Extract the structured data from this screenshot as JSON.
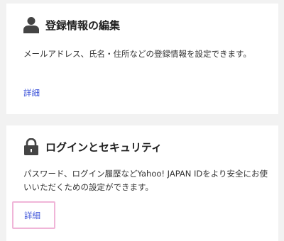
{
  "cards": [
    {
      "icon": "person-icon",
      "title": "登録情報の編集",
      "description": "メールアドレス、氏名・住所などの登録情報を設定できます。",
      "link_label": "詳細"
    },
    {
      "icon": "lock-icon",
      "title": "ログインとセキュリティ",
      "description": "パスワード、ログイン履歴などYahoo! JAPAN IDをより安全にお使いいただくための設定ができます。",
      "link_label": "詳細"
    }
  ],
  "colors": {
    "page_background": "#f2f2f2",
    "card_background": "#ffffff",
    "link": "#3a51d8",
    "focus_outline": "#f0b5d8",
    "icon": "#444444"
  }
}
